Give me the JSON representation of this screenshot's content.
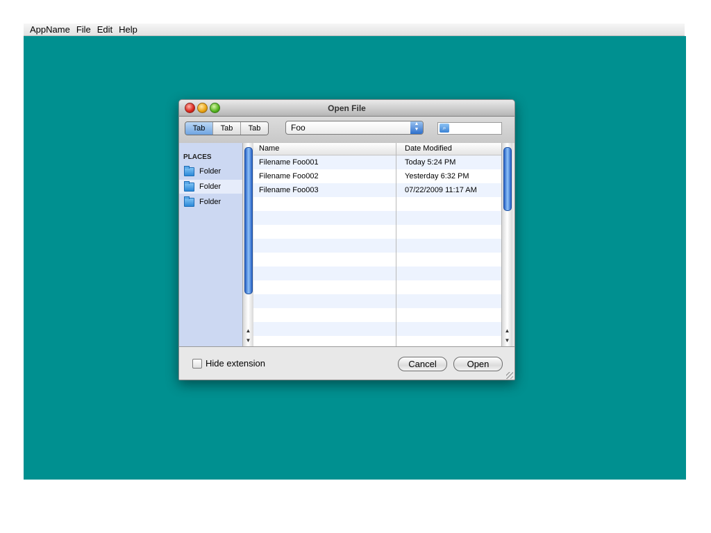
{
  "menubar": {
    "items": [
      "AppName",
      "File",
      "Edit",
      "Help"
    ]
  },
  "dialog": {
    "title": "Open File",
    "tabs": [
      "Tab",
      "Tab",
      "Tab"
    ],
    "location_popup": "Foo",
    "search": {
      "value": "",
      "icon": "search-icon"
    },
    "sidebar": {
      "section_title": "PLACES",
      "items": [
        {
          "label": "Folder",
          "icon": "folder-icon"
        },
        {
          "label": "Folder",
          "icon": "folder-icon"
        },
        {
          "label": "Folder",
          "icon": "folder-icon"
        }
      ]
    },
    "file_list": {
      "columns": [
        "Name",
        "Date Modified"
      ],
      "rows": [
        {
          "name": "Filename Foo001",
          "date": "Today 5:24 PM"
        },
        {
          "name": "Filename Foo002",
          "date": "Yesterday 6:32 PM"
        },
        {
          "name": "Filename Foo003",
          "date": "07/22/2009 11:17 AM"
        }
      ]
    },
    "hide_extension_label": "Hide extension",
    "cancel_label": "Cancel",
    "open_label": "Open"
  },
  "colors": {
    "desktop": "#009090",
    "selection_blue": "#6fa4e1",
    "sidebar_bg": "#ccd8f2",
    "row_alt": "#edf3fe"
  }
}
